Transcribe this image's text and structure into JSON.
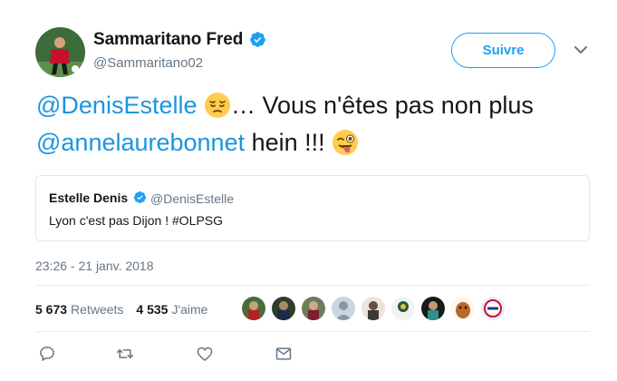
{
  "author": {
    "name": "Sammaritano Fred",
    "handle": "@Sammaritano02",
    "verified": true
  },
  "follow_button": {
    "label": "Suivre"
  },
  "tweet": {
    "mention1": "@DenisEstelle",
    "text_part1": "… Vous n'êtes pas non plus",
    "mention2": "@annelaurebonnet",
    "text_part2": " hein !!! ",
    "emoji1": "pensive-face",
    "emoji2": "winking-face-with-tongue"
  },
  "quoted_tweet": {
    "name": "Estelle Denis",
    "handle": "@DenisEstelle",
    "text": "Lyon c'est pas Dijon ! #OLPSG"
  },
  "timestamp": "23:26 - 21 janv. 2018",
  "stats": {
    "retweets_count": "5 673",
    "retweets_label": "Retweets",
    "likes_count": "4 535",
    "likes_label": "J'aime"
  },
  "likers": [
    {
      "icon": "avatar"
    },
    {
      "icon": "avatar"
    },
    {
      "icon": "avatar"
    },
    {
      "icon": "default-avatar"
    },
    {
      "icon": "avatar"
    },
    {
      "icon": "avatar"
    },
    {
      "icon": "avatar"
    },
    {
      "icon": "avatar"
    },
    {
      "icon": "avatar"
    }
  ],
  "actions": [
    "reply-icon",
    "retweet-icon",
    "like-icon",
    "message-icon"
  ],
  "colors": {
    "accent": "#1da1f2",
    "mention": "#1b95e0",
    "secondary_text": "#657786",
    "divider": "#e6ecf0"
  }
}
